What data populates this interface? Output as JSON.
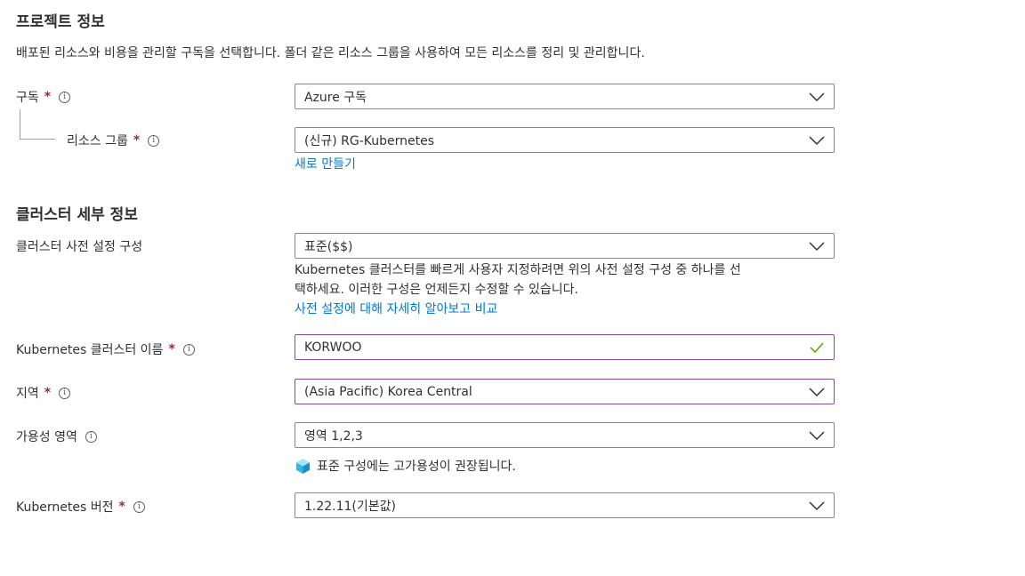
{
  "project": {
    "title": "프로젝트 정보",
    "description": "배포된 리소스와 비용을 관리할 구독을 선택합니다. 폴더 같은 리소스 그룹을 사용하여 모든 리소스를 정리 및 관리합니다.",
    "subscription": {
      "label": "구독",
      "required": "*",
      "value": "Azure 구독"
    },
    "resource_group": {
      "label": "리소스 그룹",
      "required": "*",
      "value": "(신규) RG-Kubernetes",
      "create_new": "새로 만들기"
    }
  },
  "cluster": {
    "title": "클러스터 세부 정보",
    "preset": {
      "label": "클러스터 사전 설정 구성",
      "value": "표준($$)",
      "help_line1": "Kubernetes 클러스터를 빠르게 사용자 지정하려면 위의 사전 설정 구성 중 하나를 선",
      "help_line2": "택하세요. 이러한 구성은 언제든지 수정할 수 있습니다.",
      "help_link": "사전 설정에 대해 자세히 알아보고 비교"
    },
    "name": {
      "label": "Kubernetes 클러스터 이름",
      "required": "*",
      "value": "KORWOO"
    },
    "region": {
      "label": "지역",
      "required": "*",
      "value": "(Asia Pacific) Korea Central"
    },
    "availability_zones": {
      "label": "가용성 영역",
      "value": "영역 1,2,3",
      "note": "표준 구성에는 고가용성이 권장됩니다."
    },
    "version": {
      "label": "Kubernetes 버전",
      "required": "*",
      "value": "1.22.11(기본값)"
    }
  },
  "icons": {
    "info": "i"
  },
  "colors": {
    "link": "#0078d4",
    "required": "#a4262c",
    "check": "#57a300",
    "focus_border": "#8a4a9c"
  }
}
